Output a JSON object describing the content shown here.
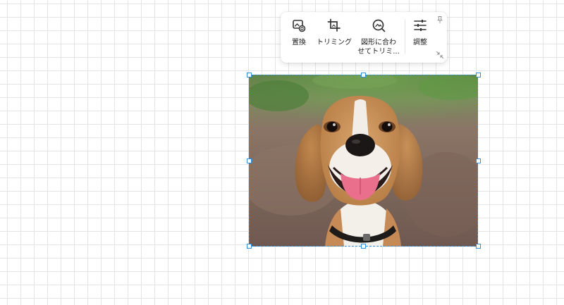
{
  "toolbar": {
    "replace_label": "置換",
    "trim_label": "トリミング",
    "shape_trim_label_line1": "図形に合わ",
    "shape_trim_label_line2": "せてトリミ...",
    "adjust_label": "調整"
  },
  "icons": {
    "replace": "replace-image-icon",
    "trim": "crop-icon",
    "shape_trim": "crop-to-shape-icon",
    "adjust": "sliders-icon",
    "pin": "pin-icon",
    "collapse": "collapse-icon"
  },
  "colors": {
    "selection": "#2f8fdc",
    "grid": "#e4e4e4"
  }
}
